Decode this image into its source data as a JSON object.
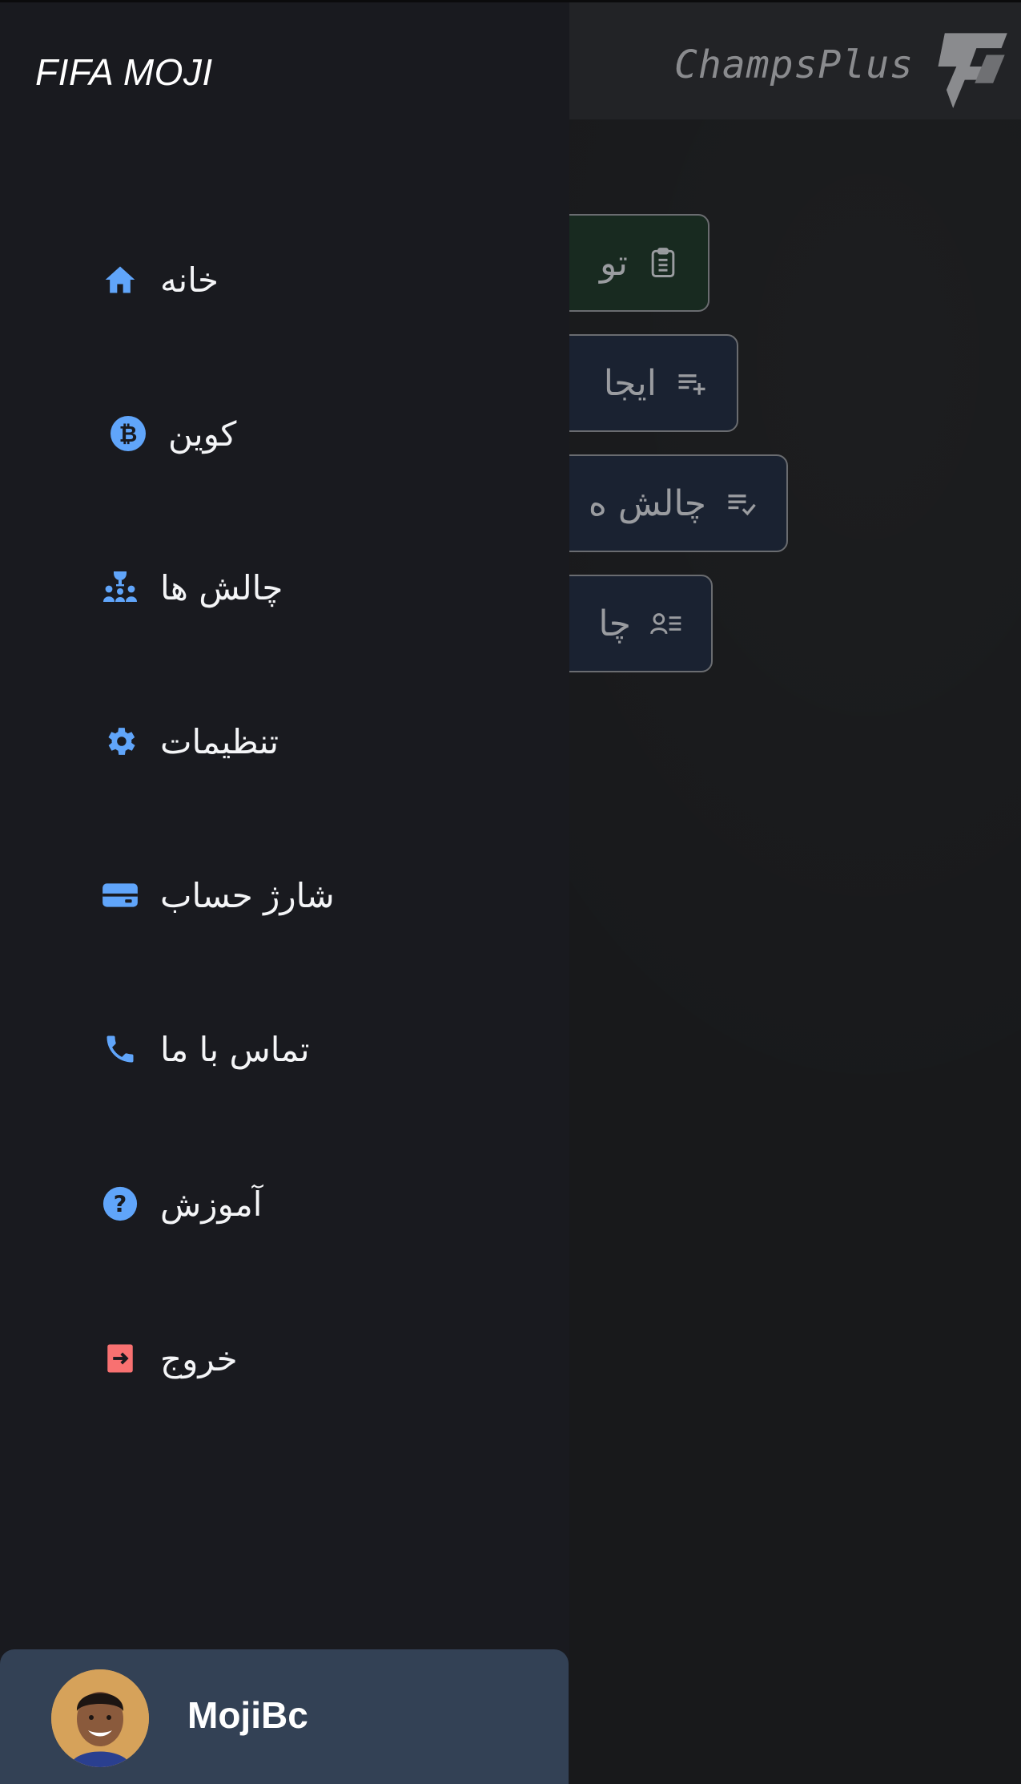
{
  "app": {
    "brand_name": "ChampsPlus"
  },
  "background_actions": [
    {
      "label": "تو",
      "icon": "clipboard-icon"
    },
    {
      "label": "ایجا",
      "icon": "playlist-add-icon"
    },
    {
      "label": "چالش ه",
      "icon": "playlist-check-icon"
    },
    {
      "label": "چا",
      "icon": "person-list-icon"
    }
  ],
  "drawer": {
    "title": "FIFA MOJI",
    "items": [
      {
        "label": "خانه",
        "icon": "home-icon"
      },
      {
        "label": "کوین",
        "icon": "bitcoin-icon"
      },
      {
        "label": "چالش ها",
        "icon": "tournament-icon"
      },
      {
        "label": "تنظیمات",
        "icon": "gear-icon"
      },
      {
        "label": "شارژ حساب",
        "icon": "credit-card-icon"
      },
      {
        "label": "تماس با ما",
        "icon": "phone-icon"
      },
      {
        "label": "آموزش",
        "icon": "question-icon"
      },
      {
        "label": "خروج",
        "icon": "logout-icon"
      }
    ]
  },
  "profile": {
    "username": "MojiBc"
  },
  "colors": {
    "drawer_bg": "#191a1f",
    "accent_blue": "#60a5fa",
    "exit_red": "#f87171",
    "profile_bg": "#334155",
    "tasks_button_bg": "#182a20",
    "action_button_bg": "#1a2231"
  }
}
